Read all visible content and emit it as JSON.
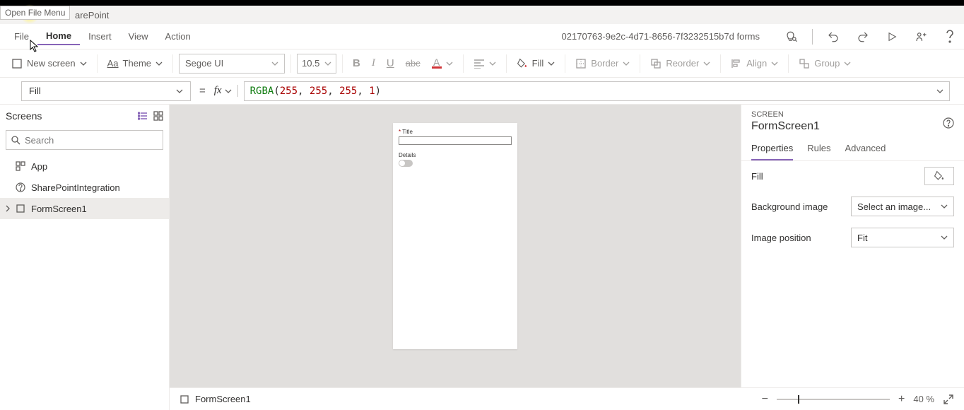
{
  "tooltip": "Open File Menu",
  "breadcrumb_suffix": "arePoint",
  "doc_id": "02170763-9e2c-4d71-8656-7f3232515b7d forms",
  "menu": {
    "file": "File",
    "home": "Home",
    "insert": "Insert",
    "view": "View",
    "action": "Action"
  },
  "toolbar": {
    "new_screen": "New screen",
    "theme": "Theme",
    "font": "Segoe UI",
    "size": "10.5",
    "fill": "Fill",
    "border": "Border",
    "reorder": "Reorder",
    "align": "Align",
    "group": "Group"
  },
  "formula": {
    "property": "Fill",
    "fn": "RGBA",
    "arg1": "255",
    "arg2": "255",
    "arg3": "255",
    "arg4": "1"
  },
  "tree": {
    "title": "Screens",
    "search_placeholder": "Search",
    "items": [
      {
        "name": "App",
        "icon": "app"
      },
      {
        "name": "SharePointIntegration",
        "icon": "question"
      },
      {
        "name": "FormScreen1",
        "icon": "screen",
        "selected": true
      }
    ]
  },
  "canvas_form": {
    "title_label": "Title",
    "details_label": "Details"
  },
  "props": {
    "section": "SCREEN",
    "name": "FormScreen1",
    "tabs": {
      "properties": "Properties",
      "rules": "Rules",
      "advanced": "Advanced"
    },
    "fill_label": "Fill",
    "bg_label": "Background image",
    "bg_select": "Select an image...",
    "imgpos_label": "Image position",
    "imgpos_select": "Fit"
  },
  "statusbar": {
    "name": "FormScreen1",
    "zoom": "40  %"
  }
}
